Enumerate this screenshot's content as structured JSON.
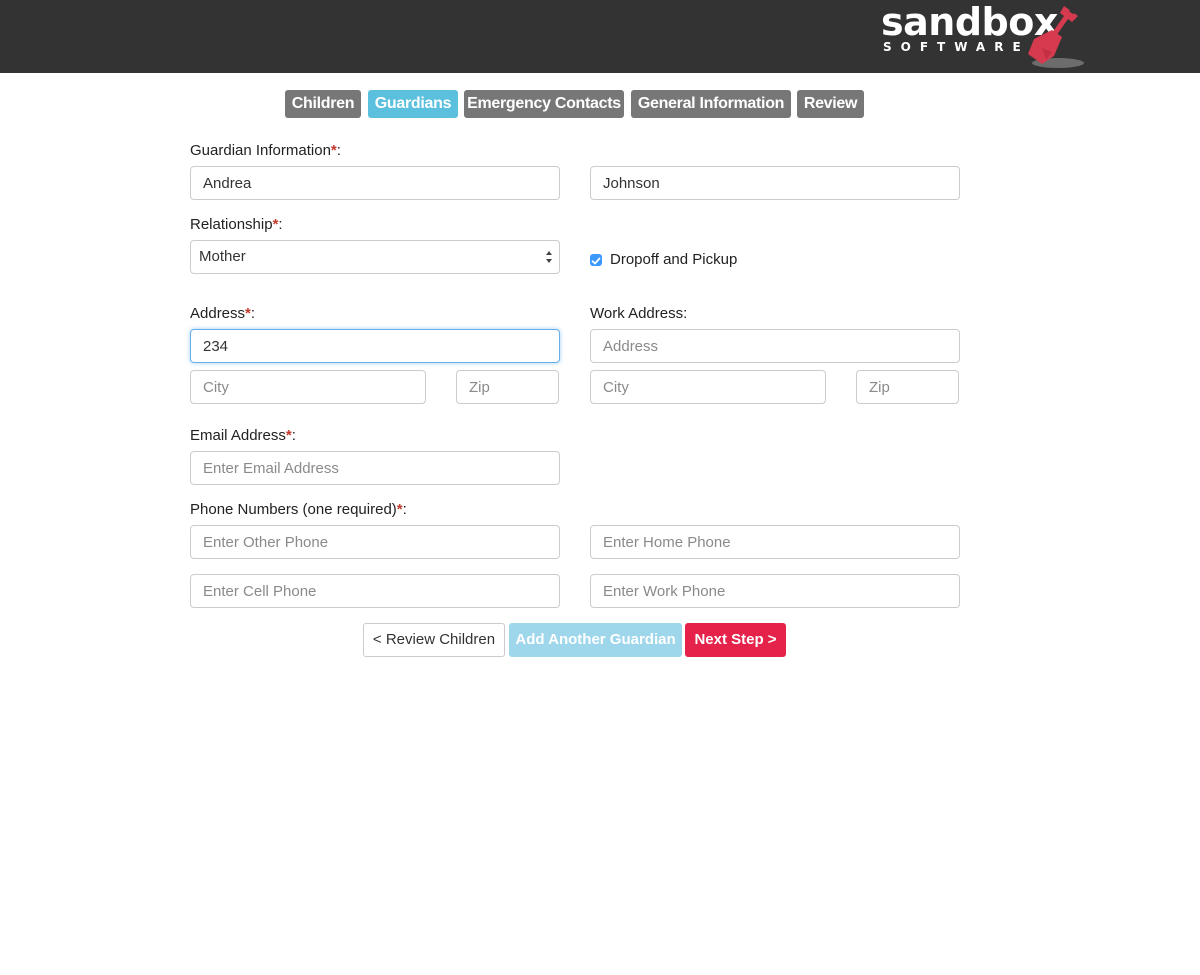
{
  "brand": {
    "name": "sandbox",
    "tagline": "SOFTWARE",
    "colors": {
      "topbar": "#333333",
      "shovel": "#d63a4f",
      "shovel_shadow": "#7a7a7a"
    }
  },
  "tabs": [
    {
      "label": "Children",
      "active": false
    },
    {
      "label": "Guardians",
      "active": true
    },
    {
      "label": "Emergency Contacts",
      "active": false
    },
    {
      "label": "General Information",
      "active": false
    },
    {
      "label": "Review",
      "active": false
    }
  ],
  "form": {
    "guardian_info": {
      "label": "Guardian Information",
      "required_mark": "*",
      "colon": ":",
      "first_name": "Andrea",
      "last_name": "Johnson"
    },
    "relationship": {
      "label": "Relationship",
      "required_mark": "*",
      "colon": ":",
      "selected": "Mother"
    },
    "dropoff": {
      "label": "Dropoff and Pickup",
      "checked": true
    },
    "address": {
      "label": "Address",
      "required_mark": "*",
      "colon": ":",
      "street_value": "234",
      "city_placeholder": "City",
      "zip_placeholder": "Zip"
    },
    "work_address": {
      "label": "Work Address:",
      "street_placeholder": "Address",
      "city_placeholder": "City",
      "zip_placeholder": "Zip"
    },
    "email": {
      "label": "Email Address",
      "required_mark": "*",
      "colon": ":",
      "placeholder": "Enter Email Address"
    },
    "phones": {
      "label": "Phone Numbers (one required)",
      "required_mark": "*",
      "colon": ":",
      "other_placeholder": "Enter Other Phone",
      "home_placeholder": "Enter Home Phone",
      "cell_placeholder": "Enter Cell Phone",
      "work_placeholder": "Enter Work Phone"
    }
  },
  "buttons": {
    "review_children": "< Review Children",
    "add_guardian": "Add Another Guardian",
    "next_step": "Next Step >"
  }
}
